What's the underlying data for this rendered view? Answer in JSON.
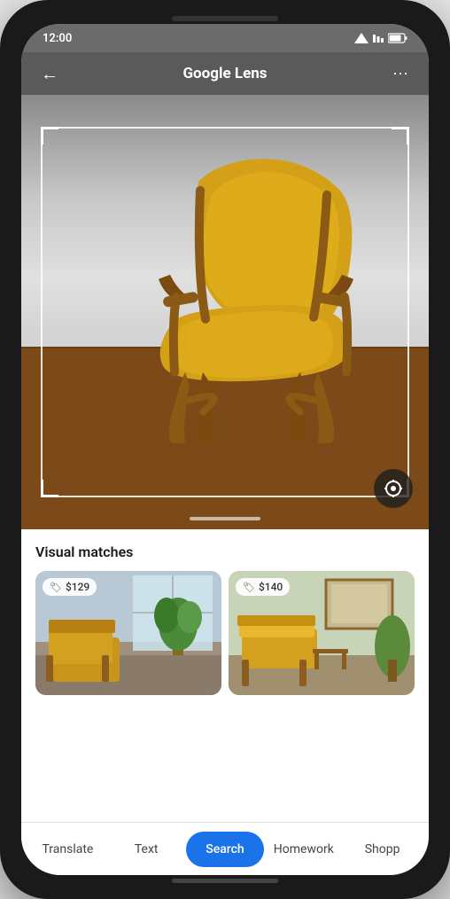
{
  "status_bar": {
    "time": "12:00",
    "signal": "▲▼",
    "wifi": "▲",
    "battery": "▮"
  },
  "nav": {
    "title_prefix": "Google ",
    "title_suffix": "Lens",
    "back_icon": "←",
    "more_icon": "⋯"
  },
  "image": {
    "alt": "Yellow mid-century modern chair with wooden frame"
  },
  "results": {
    "section_title": "Visual matches",
    "matches": [
      {
        "price": "$129",
        "alt": "Chair match 1"
      },
      {
        "price": "$140",
        "alt": "Chair match 2"
      }
    ]
  },
  "tabs": [
    {
      "id": "translate",
      "label": "Translate",
      "active": false
    },
    {
      "id": "text",
      "label": "Text",
      "active": false
    },
    {
      "id": "search",
      "label": "Search",
      "active": true
    },
    {
      "id": "homework",
      "label": "Homework",
      "active": false
    },
    {
      "id": "shopping",
      "label": "Shopp",
      "active": false,
      "partial": true
    }
  ]
}
